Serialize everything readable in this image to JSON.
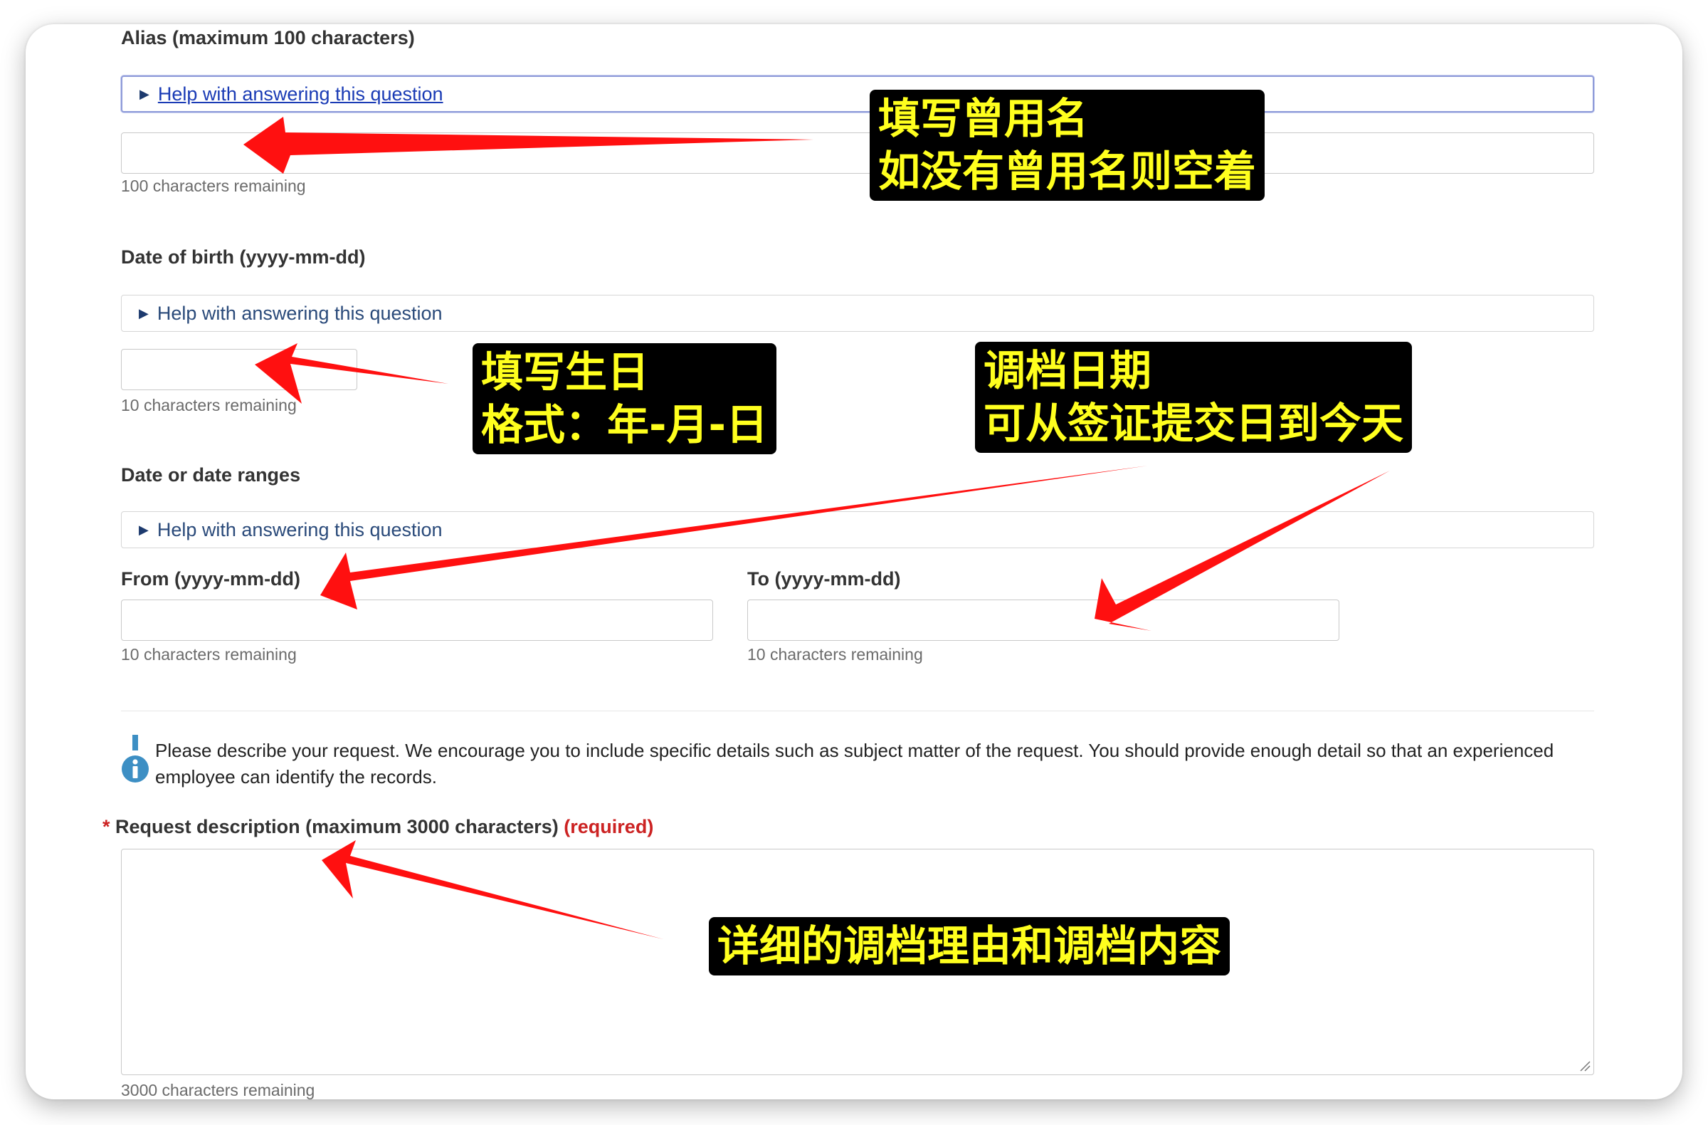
{
  "alias": {
    "label": "Alias (maximum 100 characters)",
    "help": "Help with answering this question",
    "value": "",
    "remaining": "100 characters remaining"
  },
  "dob": {
    "label": "Date of birth (yyyy-mm-dd)",
    "help": "Help with answering this question",
    "value": "",
    "remaining": "10 characters remaining"
  },
  "dates": {
    "label": "Date or date ranges",
    "help": "Help with answering this question",
    "from_label": "From (yyyy-mm-dd)",
    "from_value": "",
    "from_remaining": "10 characters remaining",
    "to_label": "To (yyyy-mm-dd)",
    "to_value": "",
    "to_remaining": "10 characters remaining"
  },
  "info": {
    "icon": "info-icon",
    "text": "Please describe your request. We encourage you to include specific details such as subject matter of the request. You should provide enough detail so that an experienced employee can identify the records."
  },
  "request": {
    "star": "*",
    "label": "Request description (maximum 3000 characters)",
    "required": "(required)",
    "value": "",
    "remaining": "3000 characters remaining"
  },
  "annotations": {
    "alias_line1": "填写曾用名",
    "alias_line2": "如没有曾用名则空着",
    "dob_line1": "填写生日",
    "dob_line2": "格式：年-月-日",
    "dates_line1": "调档日期",
    "dates_line2": "可从签证提交日到今天",
    "request_line1": "详细的调档理由和调档内容"
  },
  "colors": {
    "arrow": "#ff1010",
    "note_bg": "#000000",
    "note_text": "#ffff1e",
    "required": "#cc2222",
    "link": "#1a3bb5",
    "info_icon": "#3d8fc4"
  }
}
